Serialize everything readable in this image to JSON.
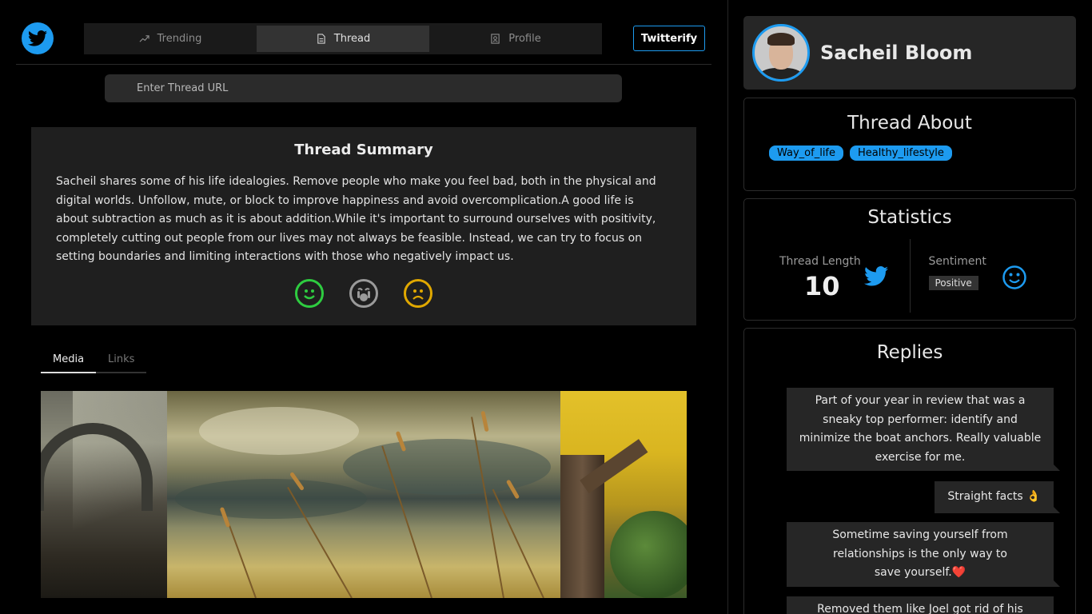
{
  "app": {
    "brand_button": "Twitterify"
  },
  "nav": {
    "tabs": [
      {
        "label": "Trending",
        "icon": "trending-icon"
      },
      {
        "label": "Thread",
        "icon": "document-icon",
        "active": true
      },
      {
        "label": "Profile",
        "icon": "profile-icon"
      }
    ]
  },
  "search": {
    "placeholder": "Enter Thread URL"
  },
  "summary": {
    "title": "Thread Summary",
    "text": "Sacheil shares some of his life idealogies. Remove people who make you feel bad, both in the physical and digital worlds. Unfollow, mute, or block to improve happiness and avoid overcomplication.A good life is about subtraction as much as it is about addition.While it's important to surround ourselves with positivity, completely cutting out people from our lives may not always be feasible. Instead, we can try to focus on setting boundaries and limiting interactions with those who negatively impact us.",
    "reactions": [
      {
        "icon": "happy-face-icon",
        "color": "#2ecc40"
      },
      {
        "icon": "shocked-face-icon",
        "color": "#9a9a9a"
      },
      {
        "icon": "sad-face-icon",
        "color": "#e0a800"
      }
    ]
  },
  "media": {
    "tabs": [
      "Media",
      "Links"
    ],
    "active_tab": "Media",
    "images": [
      "bridge-forest-image",
      "wheat-field-image",
      "autumn-tree-image"
    ]
  },
  "profile": {
    "name": "Sacheil Bloom",
    "accent": "#1d9bf0"
  },
  "about": {
    "title": "Thread About",
    "tags": [
      "Way_of_life",
      "Healthy_lifestyle"
    ]
  },
  "statistics": {
    "title": "Statistics",
    "thread_length_label": "Thread Length",
    "thread_length": "10",
    "sentiment_label": "Sentiment",
    "sentiment": "Positive"
  },
  "replies": {
    "title": "Replies",
    "items": [
      "Part of your year in review that was a sneaky top performer: identify and minimize the boat anchors. Really valuable exercise for me.",
      "Straight facts 👌",
      "Sometime saving yourself from relationships is the only way to save yourself.❤️",
      "Removed them like Joel got rid of his"
    ]
  }
}
